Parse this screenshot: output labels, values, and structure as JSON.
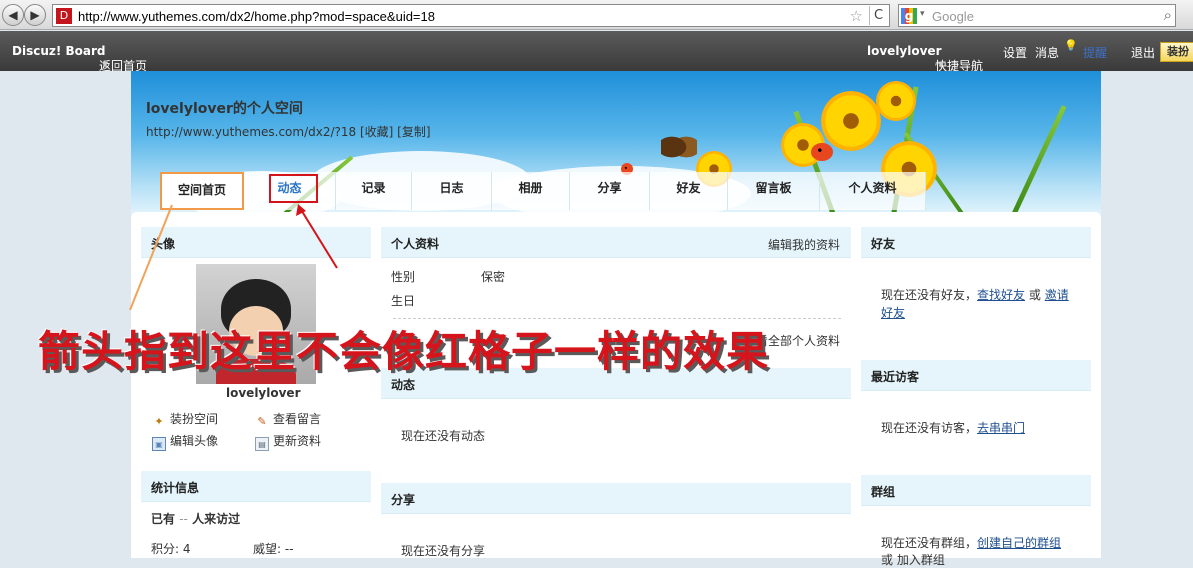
{
  "browser": {
    "back_glyph": "◀",
    "forward_glyph": "▶",
    "url": "http://www.yuthemes.com/dx2/home.php?mod=space&uid=18",
    "favicon_glyph": "D",
    "star_glyph": "☆",
    "reload_glyph": "C",
    "search_engine_glyph": "g",
    "search_placeholder": "Google",
    "search_drop_glyph": "▾",
    "magnifier_glyph": "⌕"
  },
  "topbar": {
    "site_name": "Discuz! Board",
    "back_home": "返回首页",
    "username": "lovelylover",
    "quick_nav": "快捷导航",
    "settings": "设置",
    "messages": "消息",
    "bulb_glyph": "💡",
    "reminder": "提醒",
    "logout": "退出",
    "dress_up": "装扮",
    "caret": "▾"
  },
  "space": {
    "title": "lovelylover的个人空间",
    "url_line": "http://www.yuthemes.com/dx2/?18 [收藏] [复制]"
  },
  "tabs": [
    {
      "label": "空间首页"
    },
    {
      "label": "动态"
    },
    {
      "label": "记录"
    },
    {
      "label": "日志"
    },
    {
      "label": "相册"
    },
    {
      "label": "分享"
    },
    {
      "label": "好友"
    },
    {
      "label": "留言板"
    },
    {
      "label": "个人资料"
    }
  ],
  "left": {
    "avatar_head": "头像",
    "username": "lovelylover",
    "actions": {
      "dress": "装扮空间",
      "view_msgs": "查看留言",
      "edit_avatar": "编辑头像",
      "update_profile": "更新资料"
    },
    "icons": {
      "wand": "✦",
      "pen": "✎",
      "pic": "▣",
      "card": "▤"
    },
    "stats_head": "统计信息",
    "visits_prefix": "已有",
    "visits_value": "--",
    "visits_suffix": "人来访过",
    "points": "积分: 4",
    "prestige": "威望: --"
  },
  "middle": {
    "profile_head": "个人资料",
    "edit_link": "编辑我的资料",
    "gender_label": "性别",
    "gender_value": "保密",
    "birthday_label": "生日",
    "view_all_profile": "查看全部个人资料",
    "feed_head": "动态",
    "feed_empty": "现在还没有动态",
    "share_head": "分享",
    "share_empty": "现在还没有分享"
  },
  "right": {
    "friends_head": "好友",
    "friends_text": "现在还没有好友，",
    "find_friends": "查找好友",
    "or": "或",
    "invite1": "邀请",
    "invite2": "好友",
    "visitors_head": "最近访客",
    "visitors_text": "现在还没有访客，",
    "visit_link": "去串串门",
    "groups_head": "群组",
    "groups_text": "现在还没有群组，",
    "create_group": "创建自己的群组",
    "join_group": "或 加入群组"
  },
  "annotation": {
    "text": "箭头指到这里不会像红格子一样的效果"
  },
  "colors": {
    "annotation_red": "#d6141c",
    "active_tab_border": "#f29a48",
    "link": "#1f4f8f"
  }
}
